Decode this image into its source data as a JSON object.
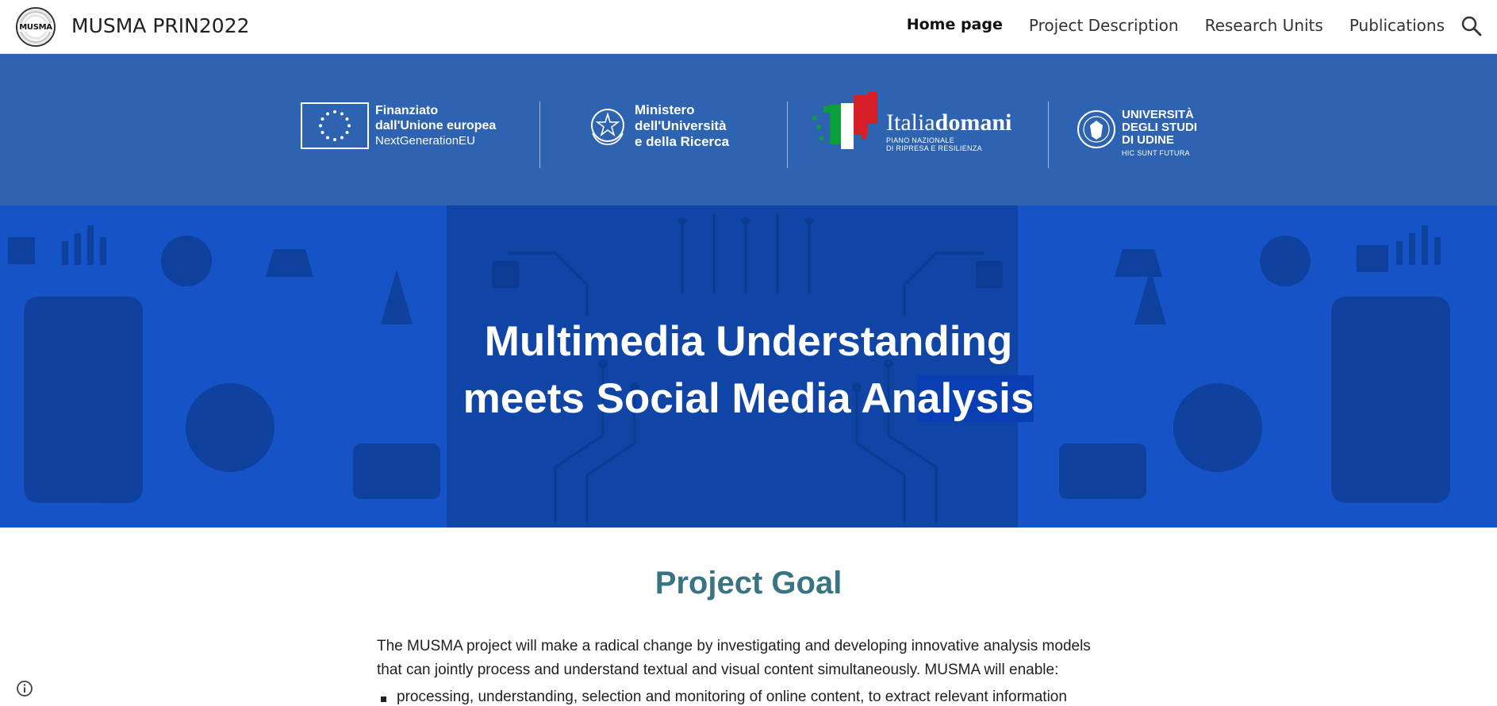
{
  "header": {
    "logo_text": "MUSMA",
    "site_title": "MUSMA PRIN2022",
    "nav": [
      {
        "label": "Home page",
        "active": true
      },
      {
        "label": "Project Description",
        "active": false
      },
      {
        "label": "Research Units",
        "active": false
      },
      {
        "label": "Publications",
        "active": false
      }
    ],
    "search_icon": "search-icon"
  },
  "funding": {
    "eu_line1": "Finanziato",
    "eu_line2": "dall'Unione europea",
    "eu_line3": "NextGenerationEU",
    "mur_line1": "Ministero",
    "mur_line2": "dell'Università",
    "mur_line3": "e della Ricerca",
    "italia_word_regular": "Italia",
    "italia_word_bold": "domani",
    "italia_sub1": "PIANO NAZIONALE",
    "italia_sub2": "DI RIPRESA E RESILIENZA",
    "udine_line1": "UNIVERSITÀ",
    "udine_line2": "DEGLI STUDI",
    "udine_line3": "DI UDINE",
    "udine_motto": "HIC SUNT FUTURA"
  },
  "hero": {
    "title_line1": "Multimedia Understanding",
    "title_line2_pre": "meets Social Media An",
    "title_line2_hl": "alysis"
  },
  "content": {
    "heading": "Project Goal",
    "paragraph": "The MUSMA project will make a radical change by investigating and developing innovative analysis models that can jointly process and understand textual and visual content simultaneously. MUSMA will enable:",
    "bullets": [
      "processing, understanding, selection and monitoring of online content, to extract relevant information"
    ]
  },
  "colors": {
    "funding_bg": "#2d63b0",
    "hero_bg": "#1553c6",
    "heading_teal": "#3a7482"
  },
  "footer": {
    "info_icon": "info-icon"
  }
}
